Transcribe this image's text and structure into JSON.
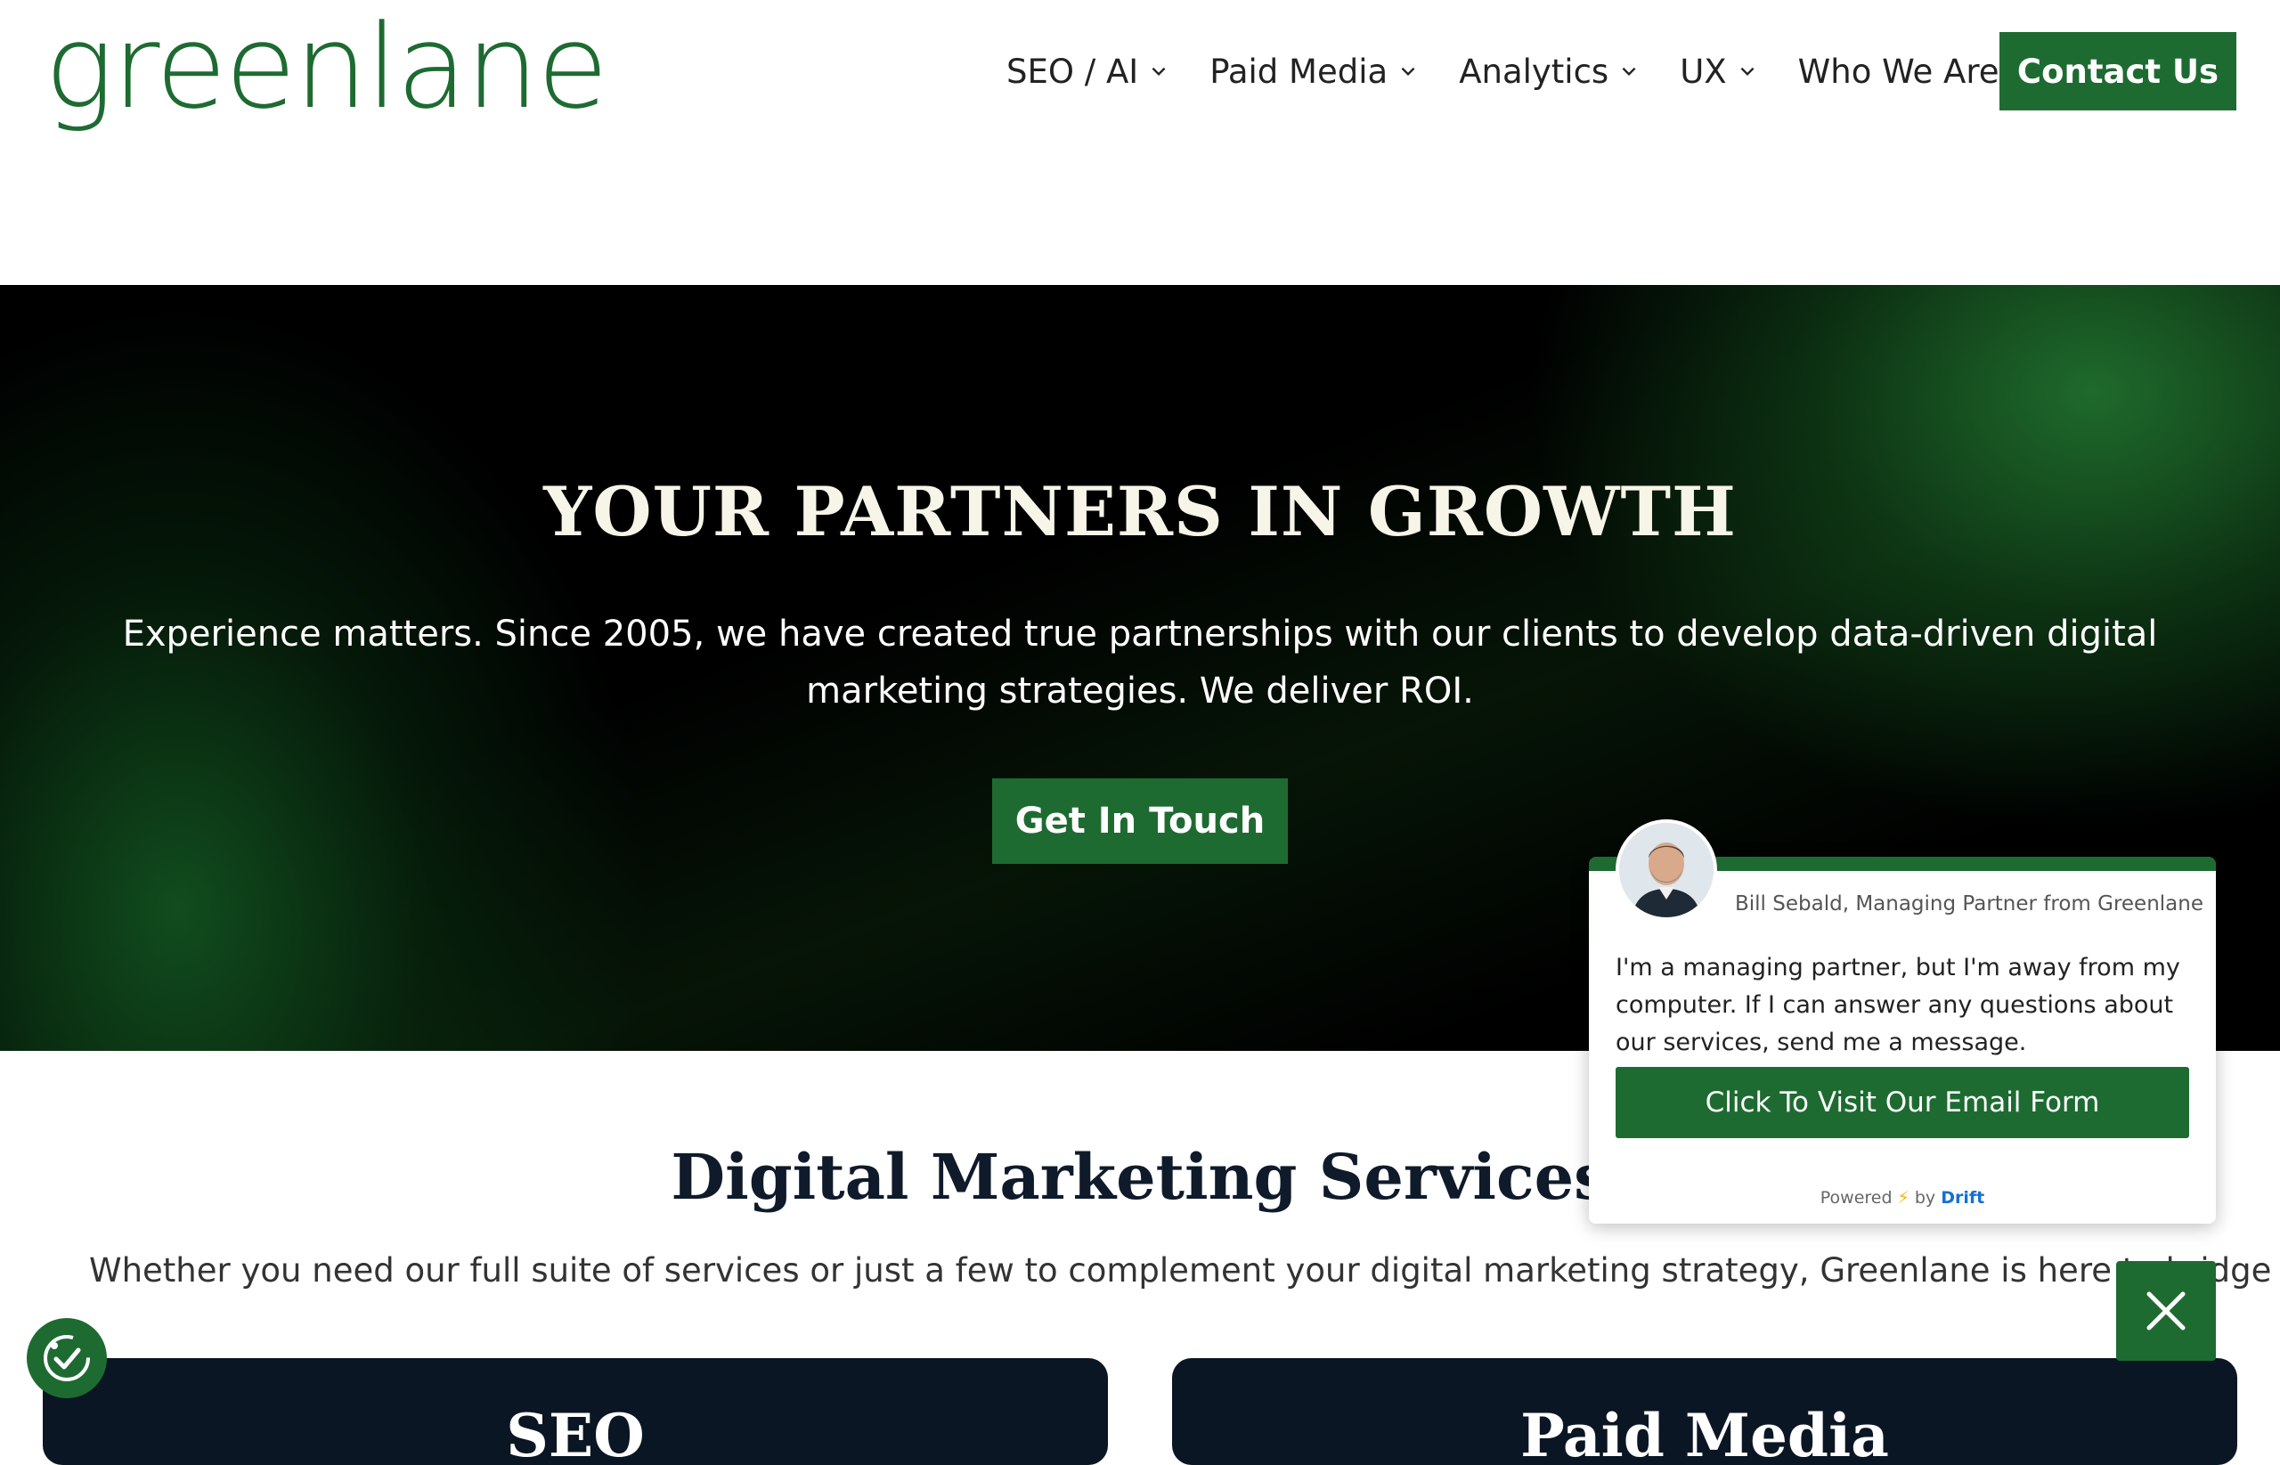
{
  "brand": {
    "logo_text": "greenlane",
    "accent": "#1e6b32"
  },
  "nav": {
    "items": [
      {
        "label": "SEO / AI"
      },
      {
        "label": "Paid Media"
      },
      {
        "label": "Analytics"
      },
      {
        "label": "UX"
      },
      {
        "label": "Who We Are"
      }
    ],
    "contact_label": "Contact Us"
  },
  "hero": {
    "title": "YOUR PARTNERS IN GROWTH",
    "subtitle": "Experience matters. Since 2005, we have created true partnerships with our clients to develop data-driven digital marketing strategies. We deliver ROI.",
    "button_label": "Get In Touch"
  },
  "services": {
    "title": "Digital Marketing Services",
    "subtitle": "Whether you need our full suite of services or just a few to complement your digital marketing strategy, Greenlane is here to bridge the g",
    "cards": [
      {
        "title": "SEO"
      },
      {
        "title": "Paid Media"
      }
    ]
  },
  "chat": {
    "agent_name": "Bill Sebald, Managing Partner from Greenlane",
    "message": "I'm a managing partner, but I'm away from my computer. If I can answer any questions about our services, send me a message.",
    "button_label": "Click To Visit Our Email Form",
    "powered_prefix": "Powered",
    "powered_suffix": "by",
    "powered_brand": "Drift"
  },
  "icons": {
    "chevron": "chevron-down-icon",
    "close": "close-icon",
    "accessibility": "accessibility-check-icon",
    "bolt": "lightning-bolt-icon"
  }
}
